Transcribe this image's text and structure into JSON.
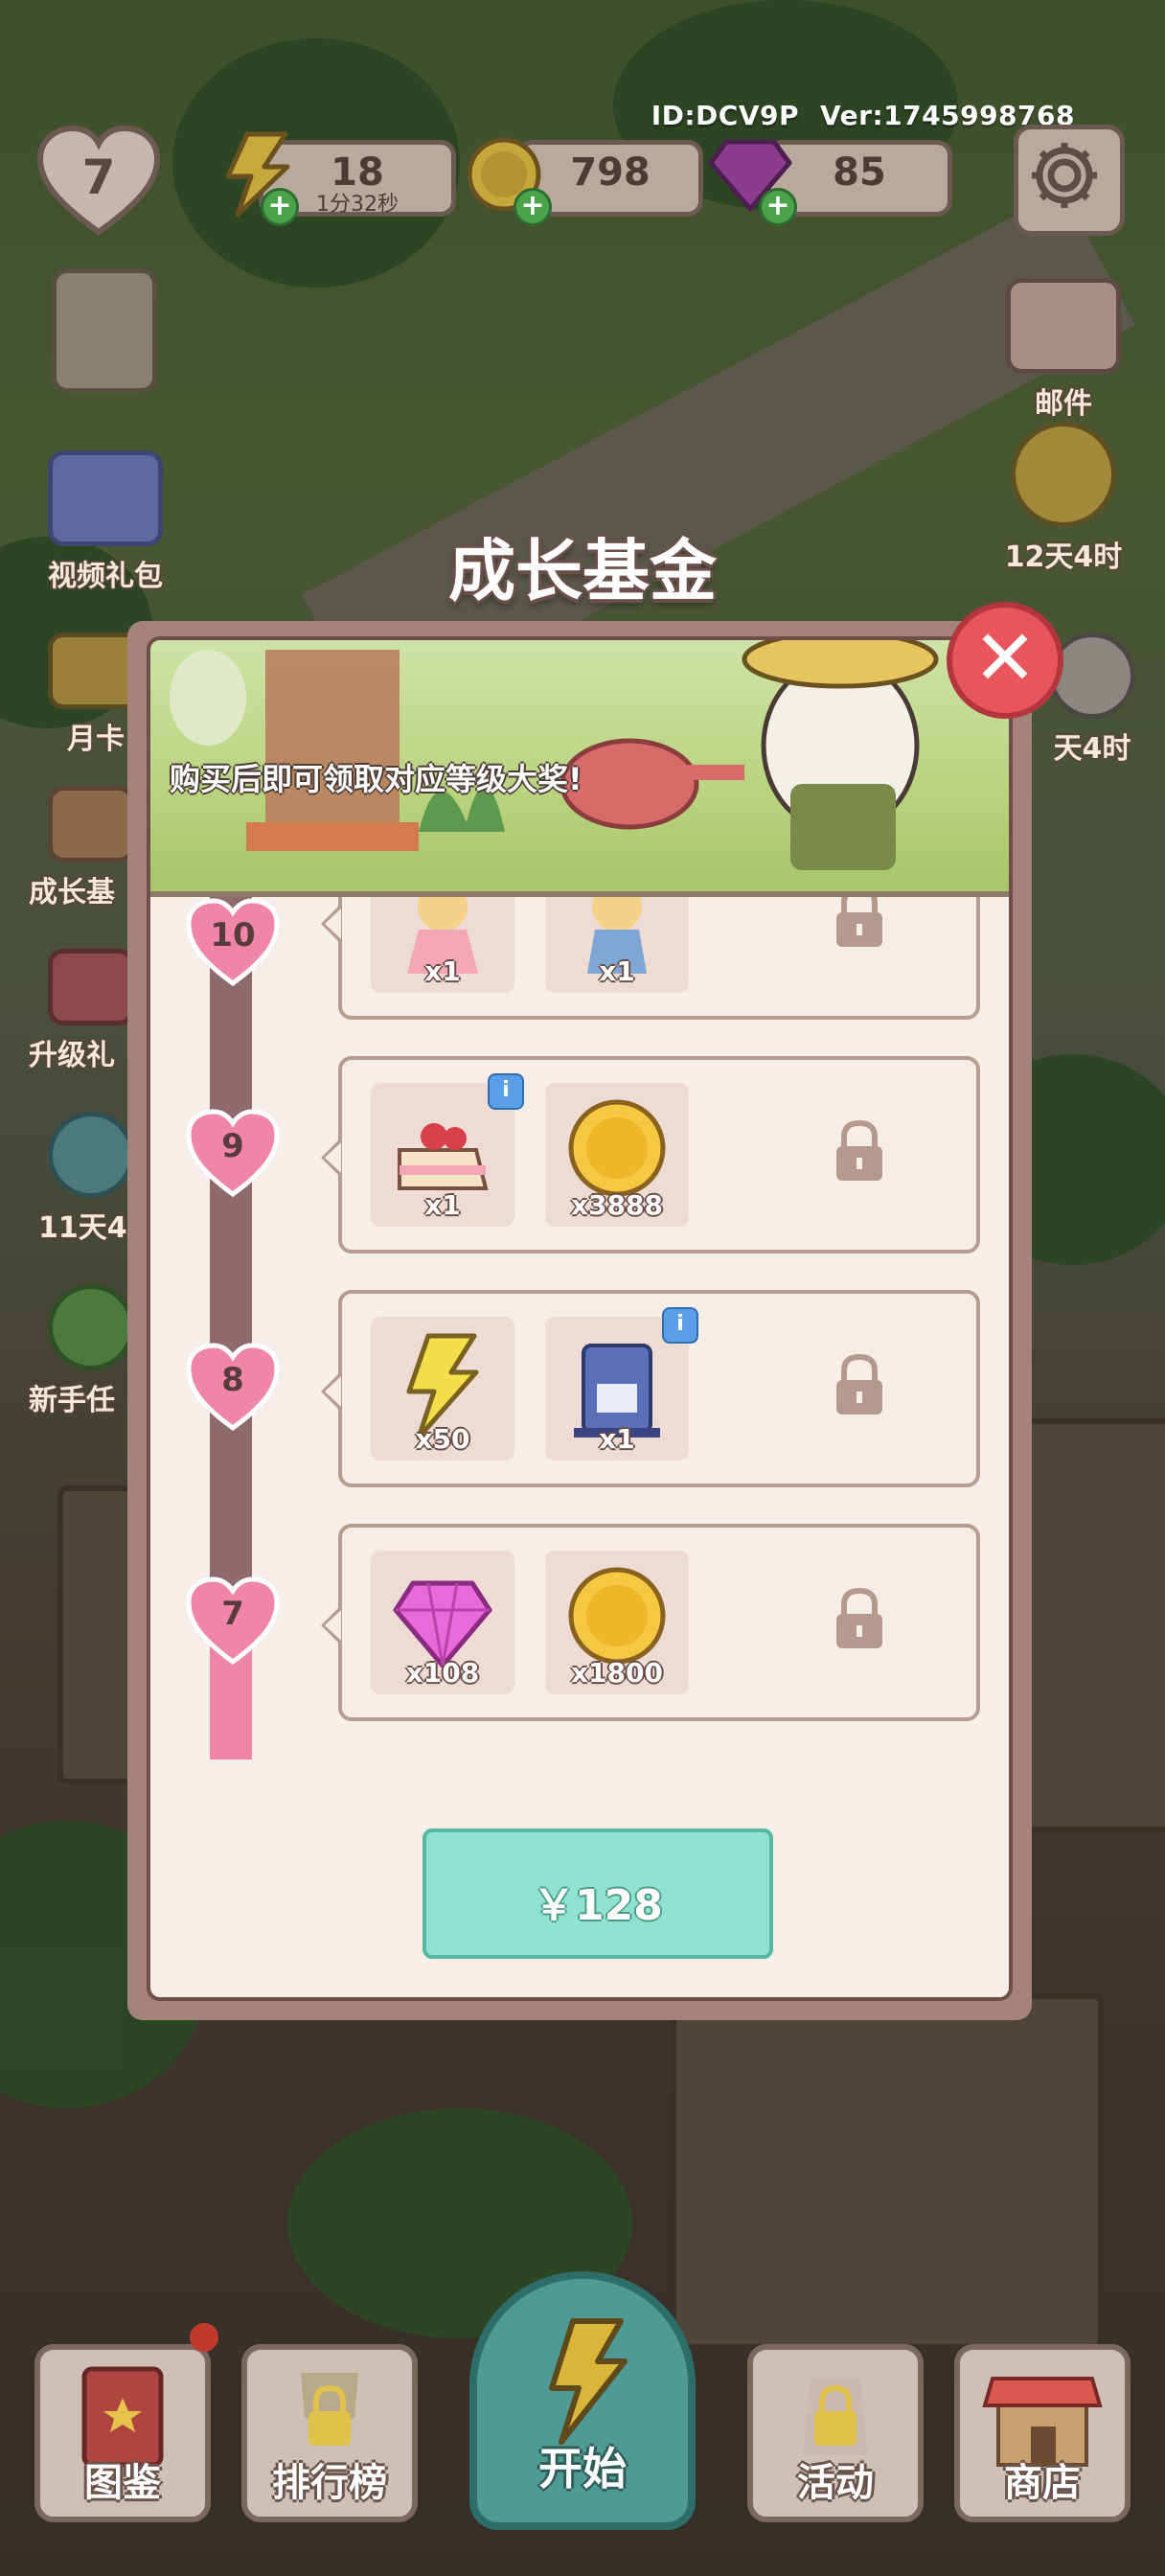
{
  "hud": {
    "player_id": "ID:DCV9P",
    "version": "Ver:1745998768",
    "level": "7",
    "energy": "18",
    "energy_timer": "1分32秒",
    "coins": "798",
    "gems": "85"
  },
  "side_left": [
    {
      "label": "视频礼包"
    },
    {
      "label": "月卡"
    },
    {
      "label": "成长基"
    },
    {
      "label": "升级礼"
    },
    {
      "label": "11天4"
    },
    {
      "label": "新手任"
    }
  ],
  "side_right": [
    {
      "label": "邮件"
    },
    {
      "label": "12天4时"
    },
    {
      "label": "天4时"
    }
  ],
  "modal": {
    "title": "成长基金",
    "banner_text": "购买后即可领取对应等级大奖!",
    "buy_label": "￥128",
    "rows": [
      {
        "level": "10",
        "rewards": [
          {
            "icon": "doll-pink-icon",
            "qty": "x1"
          },
          {
            "icon": "doll-blue-icon",
            "qty": "x1"
          }
        ]
      },
      {
        "level": "9",
        "rewards": [
          {
            "icon": "strawberry-cake-icon",
            "qty": "x1",
            "info": "i"
          },
          {
            "icon": "coin-icon",
            "qty": "x3888"
          }
        ]
      },
      {
        "level": "8",
        "rewards": [
          {
            "icon": "energy-bolt-icon",
            "qty": "x50"
          },
          {
            "icon": "coffee-machine-icon",
            "qty": "x1",
            "info": "i"
          }
        ]
      },
      {
        "level": "7",
        "rewards": [
          {
            "icon": "gem-icon",
            "qty": "x108"
          },
          {
            "icon": "coin-icon",
            "qty": "x1800"
          }
        ]
      }
    ]
  },
  "nav": {
    "collection": "图鉴",
    "leaderboard": "排行榜",
    "start": "开始",
    "activity": "活动",
    "shop": "商店"
  },
  "colors": {
    "accent_teal": "#8fe2cf",
    "close_red": "#e9555c",
    "progress_pink": "#ef86a8",
    "panel": "#f6eee8"
  }
}
